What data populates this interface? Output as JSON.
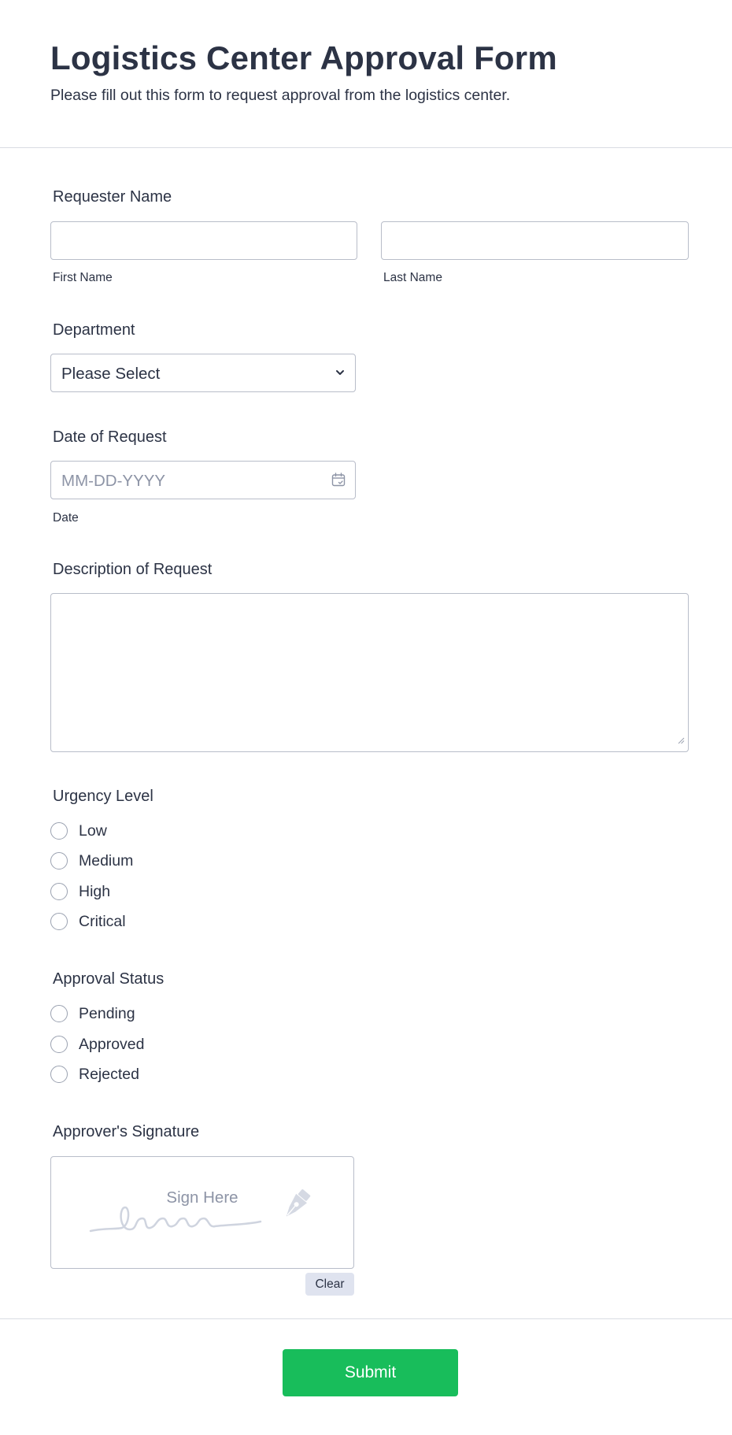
{
  "header": {
    "title": "Logistics Center Approval Form",
    "subtitle": "Please fill out this form to request approval from the logistics center."
  },
  "requester": {
    "label": "Requester Name",
    "first_value": "",
    "last_value": "",
    "first_sublabel": "First Name",
    "last_sublabel": "Last Name"
  },
  "department": {
    "label": "Department",
    "selected": "Please Select"
  },
  "date": {
    "label": "Date of Request",
    "placeholder": "MM-DD-YYYY",
    "sublabel": "Date"
  },
  "description": {
    "label": "Description of Request",
    "value": ""
  },
  "urgency": {
    "label": "Urgency Level",
    "options": [
      "Low",
      "Medium",
      "High",
      "Critical"
    ]
  },
  "approval": {
    "label": "Approval Status",
    "options": [
      "Pending",
      "Approved",
      "Rejected"
    ]
  },
  "signature": {
    "label": "Approver's Signature",
    "placeholder": "Sign Here",
    "clear_label": "Clear"
  },
  "submit": {
    "label": "Submit"
  },
  "colors": {
    "text": "#2c3345",
    "border": "#b8bdc9",
    "placeholder": "#8d94a6",
    "submit": "#18bd5b",
    "clear_bg": "#dfe3ef"
  },
  "icons": {
    "select": "chevron-down-icon",
    "date": "calendar-icon",
    "resize": "resize-grip-icon",
    "signature": "pen-nib-icon"
  }
}
